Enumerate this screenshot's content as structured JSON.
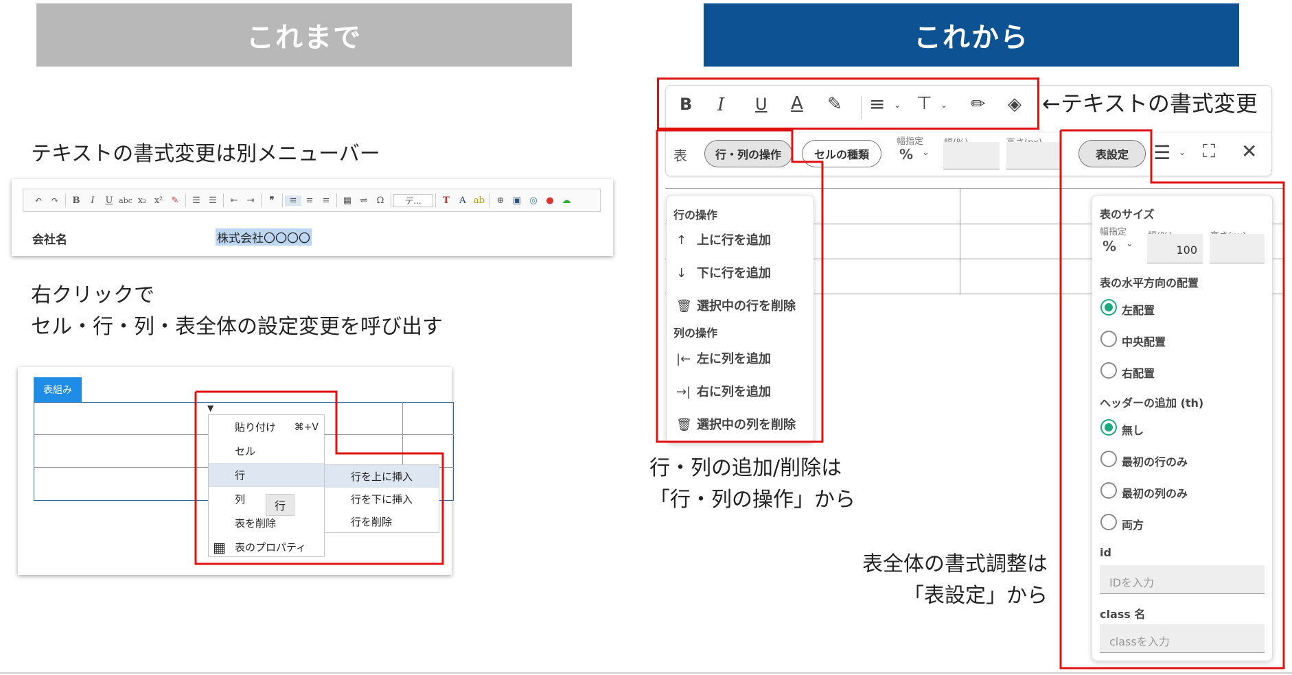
{
  "banners": {
    "old": "これまで",
    "new": "これから"
  },
  "old": {
    "caption1": "テキストの書式変更は別メニューバー",
    "caption2a": "右クリックで",
    "caption2b": "セル・行・列・表全体の設定変更を呼び出す",
    "editor": {
      "label": "会社名",
      "value": "株式会社〇〇〇〇",
      "dropdown": "デ..."
    },
    "table_tag": "表組み",
    "context_menu": {
      "items": [
        {
          "label": "貼り付け",
          "shortcut": "⌘+V"
        },
        {
          "label": "セル"
        },
        {
          "label": "行"
        },
        {
          "label": "列"
        },
        {
          "label": "表を削除"
        },
        {
          "label": "表のプロパティ"
        }
      ],
      "tooltip": "行",
      "sub": [
        "行を上に挿入",
        "行を下に挿入",
        "行を削除"
      ]
    }
  },
  "new": {
    "format_caption": "←テキストの書式変更",
    "toolbar_icons": [
      "bold-icon",
      "italic-icon",
      "underline-icon",
      "font-color-icon",
      "highlight-icon",
      "align-icon",
      "valign-icon",
      "pen-icon",
      "fill-icon"
    ],
    "row2": {
      "table_label": "表",
      "rowcol_button": "行・列の操作",
      "cell_type_button": "セルの種類",
      "width_mode_label": "幅指定",
      "width_mode_value": "%",
      "width_label": "幅(%)",
      "height_label": "高さ(px)",
      "table_settings_button": "表設定"
    },
    "rowcol_menu": {
      "row_header": "行の操作",
      "row_items": [
        {
          "icon": "↑",
          "label": "上に行を追加"
        },
        {
          "icon": "↓",
          "label": "下に行を追加"
        },
        {
          "icon": "🗑",
          "label": "選択中の行を削除"
        }
      ],
      "col_header": "列の操作",
      "col_items": [
        {
          "icon": "|←",
          "label": "左に列を追加"
        },
        {
          "icon": "→|",
          "label": "右に列を追加"
        },
        {
          "icon": "🗑",
          "label": "選択中の列を削除"
        }
      ]
    },
    "caption_rowcol_a": "行・列の追加/削除は",
    "caption_rowcol_b": "「行・列の操作」から",
    "caption_settings_a": "表全体の書式調整は",
    "caption_settings_b": "「表設定」から",
    "settings_panel": {
      "size_header": "表のサイズ",
      "width_mode_label": "幅指定",
      "width_mode_value": "%",
      "width_label": "幅(%)",
      "width_value": "100",
      "height_label": "高さ(px)",
      "halign_header": "表の水平方向の配置",
      "halign_options": [
        "左配置",
        "中央配置",
        "右配置"
      ],
      "header_header": "ヘッダーの追加 (th)",
      "header_options": [
        "無し",
        "最初の行のみ",
        "最初の列のみ",
        "両方"
      ],
      "id_label": "id",
      "id_placeholder": "IDを入力",
      "class_label": "class 名",
      "class_placeholder": "classを入力"
    }
  },
  "colors": {
    "red": "#e01010",
    "blue": "#0d5292",
    "green": "#1aa97c"
  }
}
